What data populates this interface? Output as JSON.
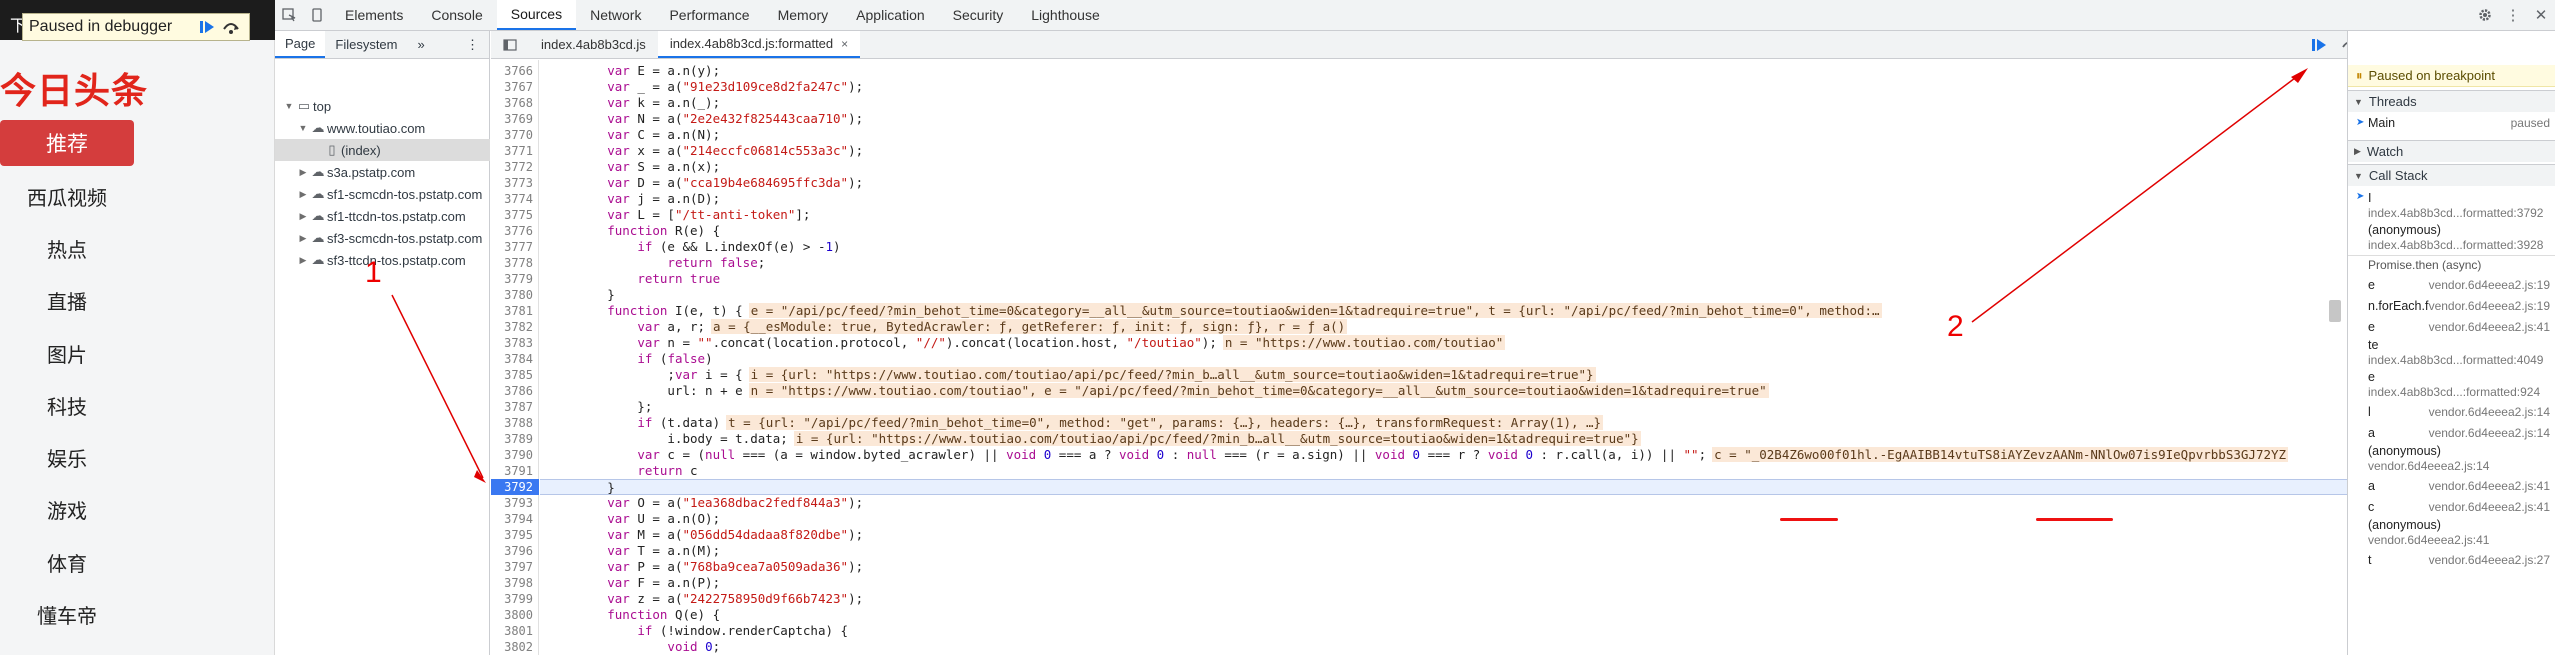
{
  "site": {
    "tab_fragment": "下",
    "debugger_label": "Paused in debugger",
    "logo": "今日头条",
    "active_nav": "推荐",
    "nav": [
      "西瓜视频",
      "热点",
      "直播",
      "图片",
      "科技",
      "娱乐",
      "游戏",
      "体育",
      "懂车帝"
    ]
  },
  "devtools": {
    "tabs": [
      "Elements",
      "Console",
      "Sources",
      "Network",
      "Performance",
      "Memory",
      "Application",
      "Security",
      "Lighthouse"
    ],
    "active_tab": "Sources",
    "navigator_tabs": [
      "Page",
      "Filesystem"
    ],
    "more": "»",
    "tree": [
      {
        "label": "top",
        "indent": 0,
        "icon": "frame"
      },
      {
        "label": "www.toutiao.com",
        "indent": 1,
        "icon": "cloud"
      },
      {
        "label": "(index)",
        "indent": 2,
        "icon": "file",
        "selected": true
      },
      {
        "label": "s3a.pstatp.com",
        "indent": 1,
        "icon": "cloud"
      },
      {
        "label": "sf1-scmcdn-tos.pstatp.com",
        "indent": 1,
        "icon": "cloud"
      },
      {
        "label": "sf1-ttcdn-tos.pstatp.com",
        "indent": 1,
        "icon": "cloud"
      },
      {
        "label": "sf3-scmcdn-tos.pstatp.com",
        "indent": 1,
        "icon": "cloud"
      },
      {
        "label": "sf3-ttcdn-tos.pstatp.com",
        "indent": 1,
        "icon": "cloud"
      }
    ],
    "editor_tabs": [
      "index.4ab8b3cd.js",
      "index.4ab8b3cd.js:formatted"
    ],
    "close_glyph": "×"
  },
  "code": [
    {
      "n": "3766",
      "t": "        var E = a.n(y);"
    },
    {
      "n": "3767",
      "t": "        var _ = a(\"91e23d109ce8d2fa247c\");"
    },
    {
      "n": "3768",
      "t": "        var k = a.n(_);"
    },
    {
      "n": "3769",
      "t": "        var N = a(\"2e2e432f825443caa710\");"
    },
    {
      "n": "3770",
      "t": "        var C = a.n(N);"
    },
    {
      "n": "3771",
      "t": "        var x = a(\"214eccfc06814c553a3c\");"
    },
    {
      "n": "3772",
      "t": "        var S = a.n(x);"
    },
    {
      "n": "3773",
      "t": "        var D = a(\"cca19b4e684695ffc3da\");"
    },
    {
      "n": "3774",
      "t": "        var j = a.n(D);"
    },
    {
      "n": "3775",
      "t": "        var L = [\"/tt-anti-token\"];"
    },
    {
      "n": "3776",
      "t": "        function R(e) {"
    },
    {
      "n": "3777",
      "t": "            if (e && L.indexOf(e) > -1)"
    },
    {
      "n": "3778",
      "t": "                return false;"
    },
    {
      "n": "3779",
      "t": "            return true"
    },
    {
      "n": "3780",
      "t": "        }"
    },
    {
      "n": "3781",
      "t": "        function I(e, t) {",
      "i": "e = \"/api/pc/feed/?min_behot_time=0&category=__all__&utm_source=toutiao&widen=1&tadrequire=true\", t = {url: \"/api/pc/feed/?min_behot_time=0\", method:…"
    },
    {
      "n": "3782",
      "t": "            var a, r;",
      "i": "a = {__esModule: true, BytedAcrawler: ƒ, getReferer: ƒ, init: ƒ, sign: ƒ}, r = ƒ a()"
    },
    {
      "n": "3783",
      "t": "            var n = \"\".concat(location.protocol, \"//\").concat(location.host, \"/toutiao\");",
      "i": "n = \"https://www.toutiao.com/toutiao\""
    },
    {
      "n": "3784",
      "t": "            if (false)"
    },
    {
      "n": "3785",
      "t": "                ;var i = {",
      "i": "i = {url: \"https://www.toutiao.com/toutiao/api/pc/feed/?min_b…all__&utm_source=toutiao&widen=1&tadrequire=true\"}"
    },
    {
      "n": "3786",
      "t": "                url: n + e",
      "i": "n = \"https://www.toutiao.com/toutiao\", e = \"/api/pc/feed/?min_behot_time=0&category=__all__&utm_source=toutiao&widen=1&tadrequire=true\""
    },
    {
      "n": "3787",
      "t": "            };"
    },
    {
      "n": "3788",
      "t": "            if (t.data)",
      "i": "t = {url: \"/api/pc/feed/?min_behot_time=0\", method: \"get\", params: {…}, headers: {…}, transformRequest: Array(1), …}"
    },
    {
      "n": "3789",
      "t": "                i.body = t.data;",
      "i": "i = {url: \"https://www.toutiao.com/toutiao/api/pc/feed/?min_b…all__&utm_source=toutiao&widen=1&tadrequire=true\"}"
    },
    {
      "n": "3790",
      "t": "            var c = (null === (a = window.byted_acrawler) || void 0 === a ? void 0 : null === (r = a.sign) || void 0 === r ? void 0 : r.call(a, i)) || \"\";",
      "i": "c = \"_02B4Z6wo00f01hl.-EgAAIBB14vtuTS8iAYZevzAANm-NNlOw07is9IeQpvrbbS3GJ72YZ"
    },
    {
      "n": "3791",
      "t": "            return c"
    },
    {
      "n": "3792",
      "t": "        }",
      "cur": true
    },
    {
      "n": "3793",
      "t": "        var O = a(\"1ea368dbac2fedf844a3\");"
    },
    {
      "n": "3794",
      "t": "        var U = a.n(O);"
    },
    {
      "n": "3795",
      "t": "        var M = a(\"056dd54dadaa8f820dbe\");"
    },
    {
      "n": "3796",
      "t": "        var T = a.n(M);"
    },
    {
      "n": "3797",
      "t": "        var P = a(\"768ba9cea7a0509ada36\");"
    },
    {
      "n": "3798",
      "t": "        var F = a.n(P);"
    },
    {
      "n": "3799",
      "t": "        var z = a(\"2422758950d9f66b7423\");"
    },
    {
      "n": "3800",
      "t": "        function Q(e) {"
    },
    {
      "n": "3801",
      "t": "            if (!window.renderCaptcha) {"
    },
    {
      "n": "3802",
      "t": "                void 0;"
    }
  ],
  "sidebar": {
    "paused": "Paused on breakpoint",
    "sections": {
      "threads": "Threads",
      "watch": "Watch",
      "callstack": "Call Stack"
    },
    "thread": {
      "name": "Main",
      "state": "paused"
    },
    "async_label": "Promise.then (async)",
    "frames": [
      {
        "fn": "I",
        "loc": "index.4ab8b3cd...formatted:3792",
        "two": true,
        "current": true
      },
      {
        "fn": "(anonymous)",
        "loc": "index.4ab8b3cd...formatted:3928",
        "two": true
      },
      {
        "fn": "e",
        "loc": "vendor.6d4eeea2.js:19"
      },
      {
        "fn": "n.forEach.f.<computed>",
        "loc": "vendor.6d4eeea2.js:19"
      },
      {
        "fn": "e",
        "loc": "vendor.6d4eeea2.js:41"
      },
      {
        "fn": "te",
        "loc": "index.4ab8b3cd...formatted:4049",
        "two": true
      },
      {
        "fn": "e",
        "loc": "index.4ab8b3cd...:formatted:924",
        "two": true
      },
      {
        "fn": "l",
        "loc": "vendor.6d4eeea2.js:14"
      },
      {
        "fn": "a",
        "loc": "vendor.6d4eeea2.js:14"
      },
      {
        "fn": "(anonymous)",
        "loc": "vendor.6d4eeea2.js:14",
        "two": true
      },
      {
        "fn": "a",
        "loc": "vendor.6d4eeea2.js:41"
      },
      {
        "fn": "c",
        "loc": "vendor.6d4eeea2.js:41"
      },
      {
        "fn": "(anonymous)",
        "loc": "vendor.6d4eeea2.js:41",
        "two": true
      },
      {
        "fn": "t",
        "loc": "vendor.6d4eeea2.js:27"
      }
    ]
  },
  "annotations": {
    "label1": "1",
    "label2": "2",
    "color": "#e00000"
  },
  "colors": {
    "breakpoint": "#3a78f1",
    "accent": "#1a73e8",
    "logo": "#e1251b",
    "active_nav": "#d43d3d"
  }
}
